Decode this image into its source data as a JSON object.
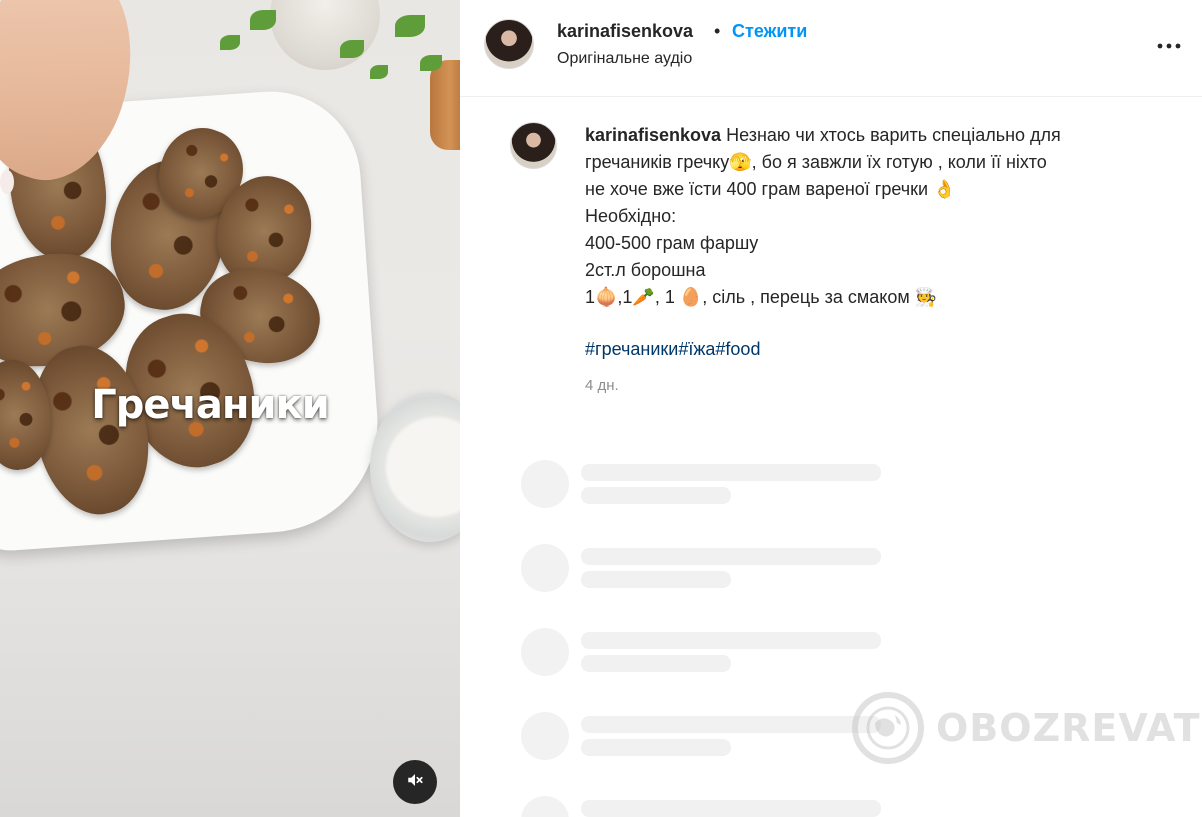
{
  "media": {
    "overlay_text": "Гречаники",
    "mute_icon": "speaker-muted-icon"
  },
  "header": {
    "username": "karinafisenkova",
    "separator": "•",
    "follow_label": "Стежити",
    "audio_label": "Оригінальне аудіо",
    "more_icon": "more-horizontal-icon"
  },
  "caption": {
    "username": "karinafisenkova",
    "lines": [
      "Незнаю чи хтось варить спеціально для",
      "гречаників гречку🫣, бо я завжли їх готую , коли її ніхто",
      "не хоче вже їсти 400 грам вареної гречки 👌",
      "Необхідно:",
      "400-500 грам фаршу",
      "2ст.л борошна",
      "1🧅,1🥕, 1 🥚, сіль , перець за смаком 🧑‍🍳"
    ],
    "hashtags": [
      "#гречаники",
      "#їжа",
      "#food"
    ],
    "time_ago": "4 дн."
  },
  "watermark": {
    "text": "OBOZREVATEL",
    "icon": "globe-icon"
  },
  "colors": {
    "accent": "#0095f6",
    "hashtag": "#00376b",
    "muted_text": "#8e8e8e"
  }
}
